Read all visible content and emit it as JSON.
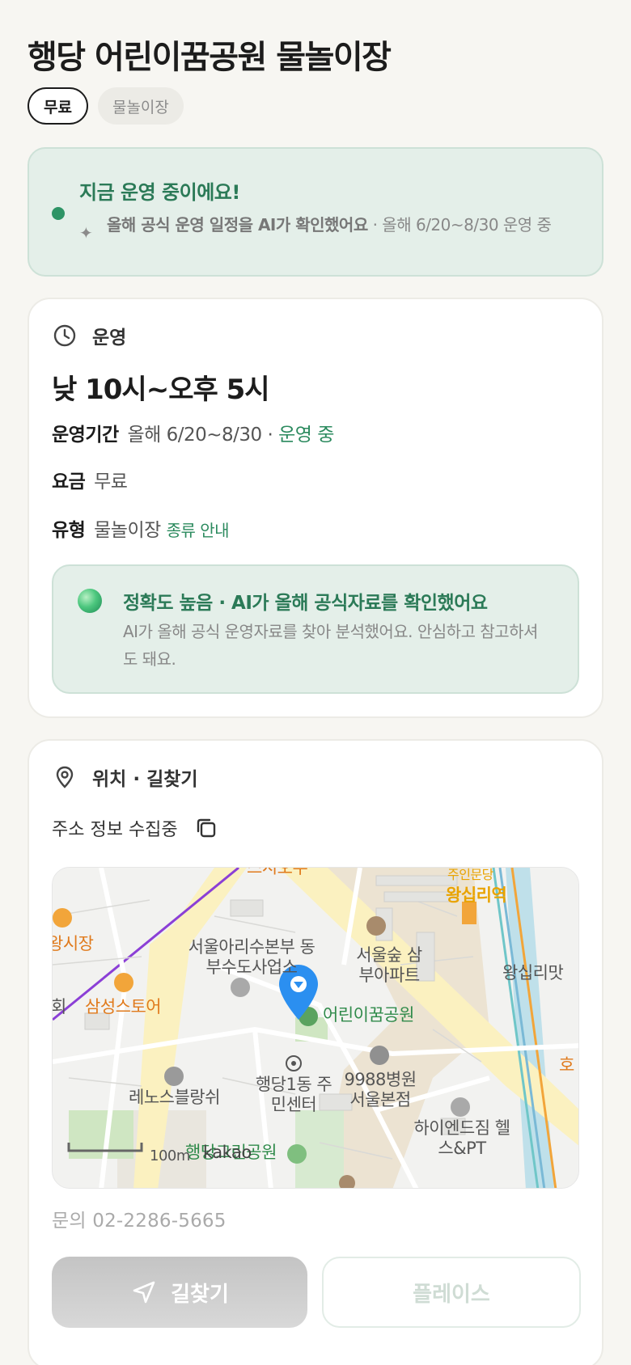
{
  "place": {
    "title": "행당 어린이꿈공원 물놀이장",
    "chips": {
      "fee": "무료",
      "type": "물놀이장"
    }
  },
  "status": {
    "headline": "지금 운영 중이에요!",
    "ai_note_bold": "올해 공식 운영 일정을 AI가 확인했어요",
    "ai_note_rest": " · 올해 6/20~8/30 운영 중"
  },
  "operation": {
    "section_label": "운영",
    "hours": "낮 10시~오후 5시",
    "period_label": "운영기간",
    "period_value": "올해 6/20~8/30 · ",
    "period_status": "운영 중",
    "fee_label": "요금",
    "fee_value": "무료",
    "type_label": "유형",
    "type_value": "물놀이장",
    "type_link": "종류 안내",
    "accuracy_title": "정확도 높음 · AI가 올해 공식자료를 확인했어요",
    "accuracy_desc": "AI가 올해 공식 운영자료를 찾아 분석했어요. 안심하고 참고하셔도 돼요."
  },
  "location": {
    "section_label": "위치 · 길찾기",
    "address": "주소 정보 수집중",
    "map_labels": {
      "market": "왕시장",
      "water_office": "서울아리수본부 동부수도사업소",
      "forest": "서울숲 삼부아파트",
      "station": "왕십리역",
      "station_exit": "주인문당",
      "wangsimni": "왕십리맛",
      "samsung": "삼성스토어",
      "hoe": "회",
      "park": "어린이꿈공원",
      "renos": "레노스블랑쉬",
      "center": "행당1동 주민센터",
      "hospital": "9988병원 서울본점",
      "gym": "하이엔드짐 헬스&PT",
      "green_park": "행당그린공원",
      "ho": "호",
      "top_road": "스시오우",
      "scale": "100m",
      "brand": "kakao"
    },
    "phone": "문의 02-2286-5665",
    "nav_button": "길찾기",
    "place_button": "플레이스"
  }
}
